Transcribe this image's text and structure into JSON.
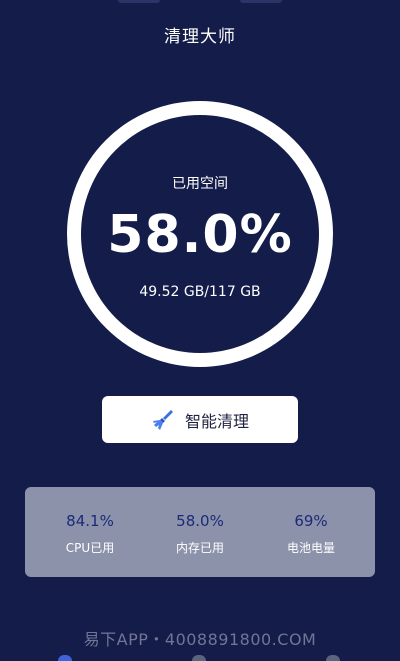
{
  "header": {
    "title": "清理大师"
  },
  "storage": {
    "label": "已用空间",
    "percent": "58.0%",
    "size": "49.52 GB/117 GB"
  },
  "clean_button": {
    "label": "智能清理",
    "icon": "broom-icon"
  },
  "stats": [
    {
      "value": "84.1%",
      "label": "CPU已用"
    },
    {
      "value": "58.0%",
      "label": "内存已用"
    },
    {
      "value": "69%",
      "label": "电池电量"
    }
  ],
  "watermark": "易下APP・4008891800.COM",
  "colors": {
    "background": "#141c49",
    "ring": "#ffffff",
    "stats_panel": "#8b92a9",
    "stat_value": "#1d2a7a",
    "accent": "#3d63d9"
  }
}
